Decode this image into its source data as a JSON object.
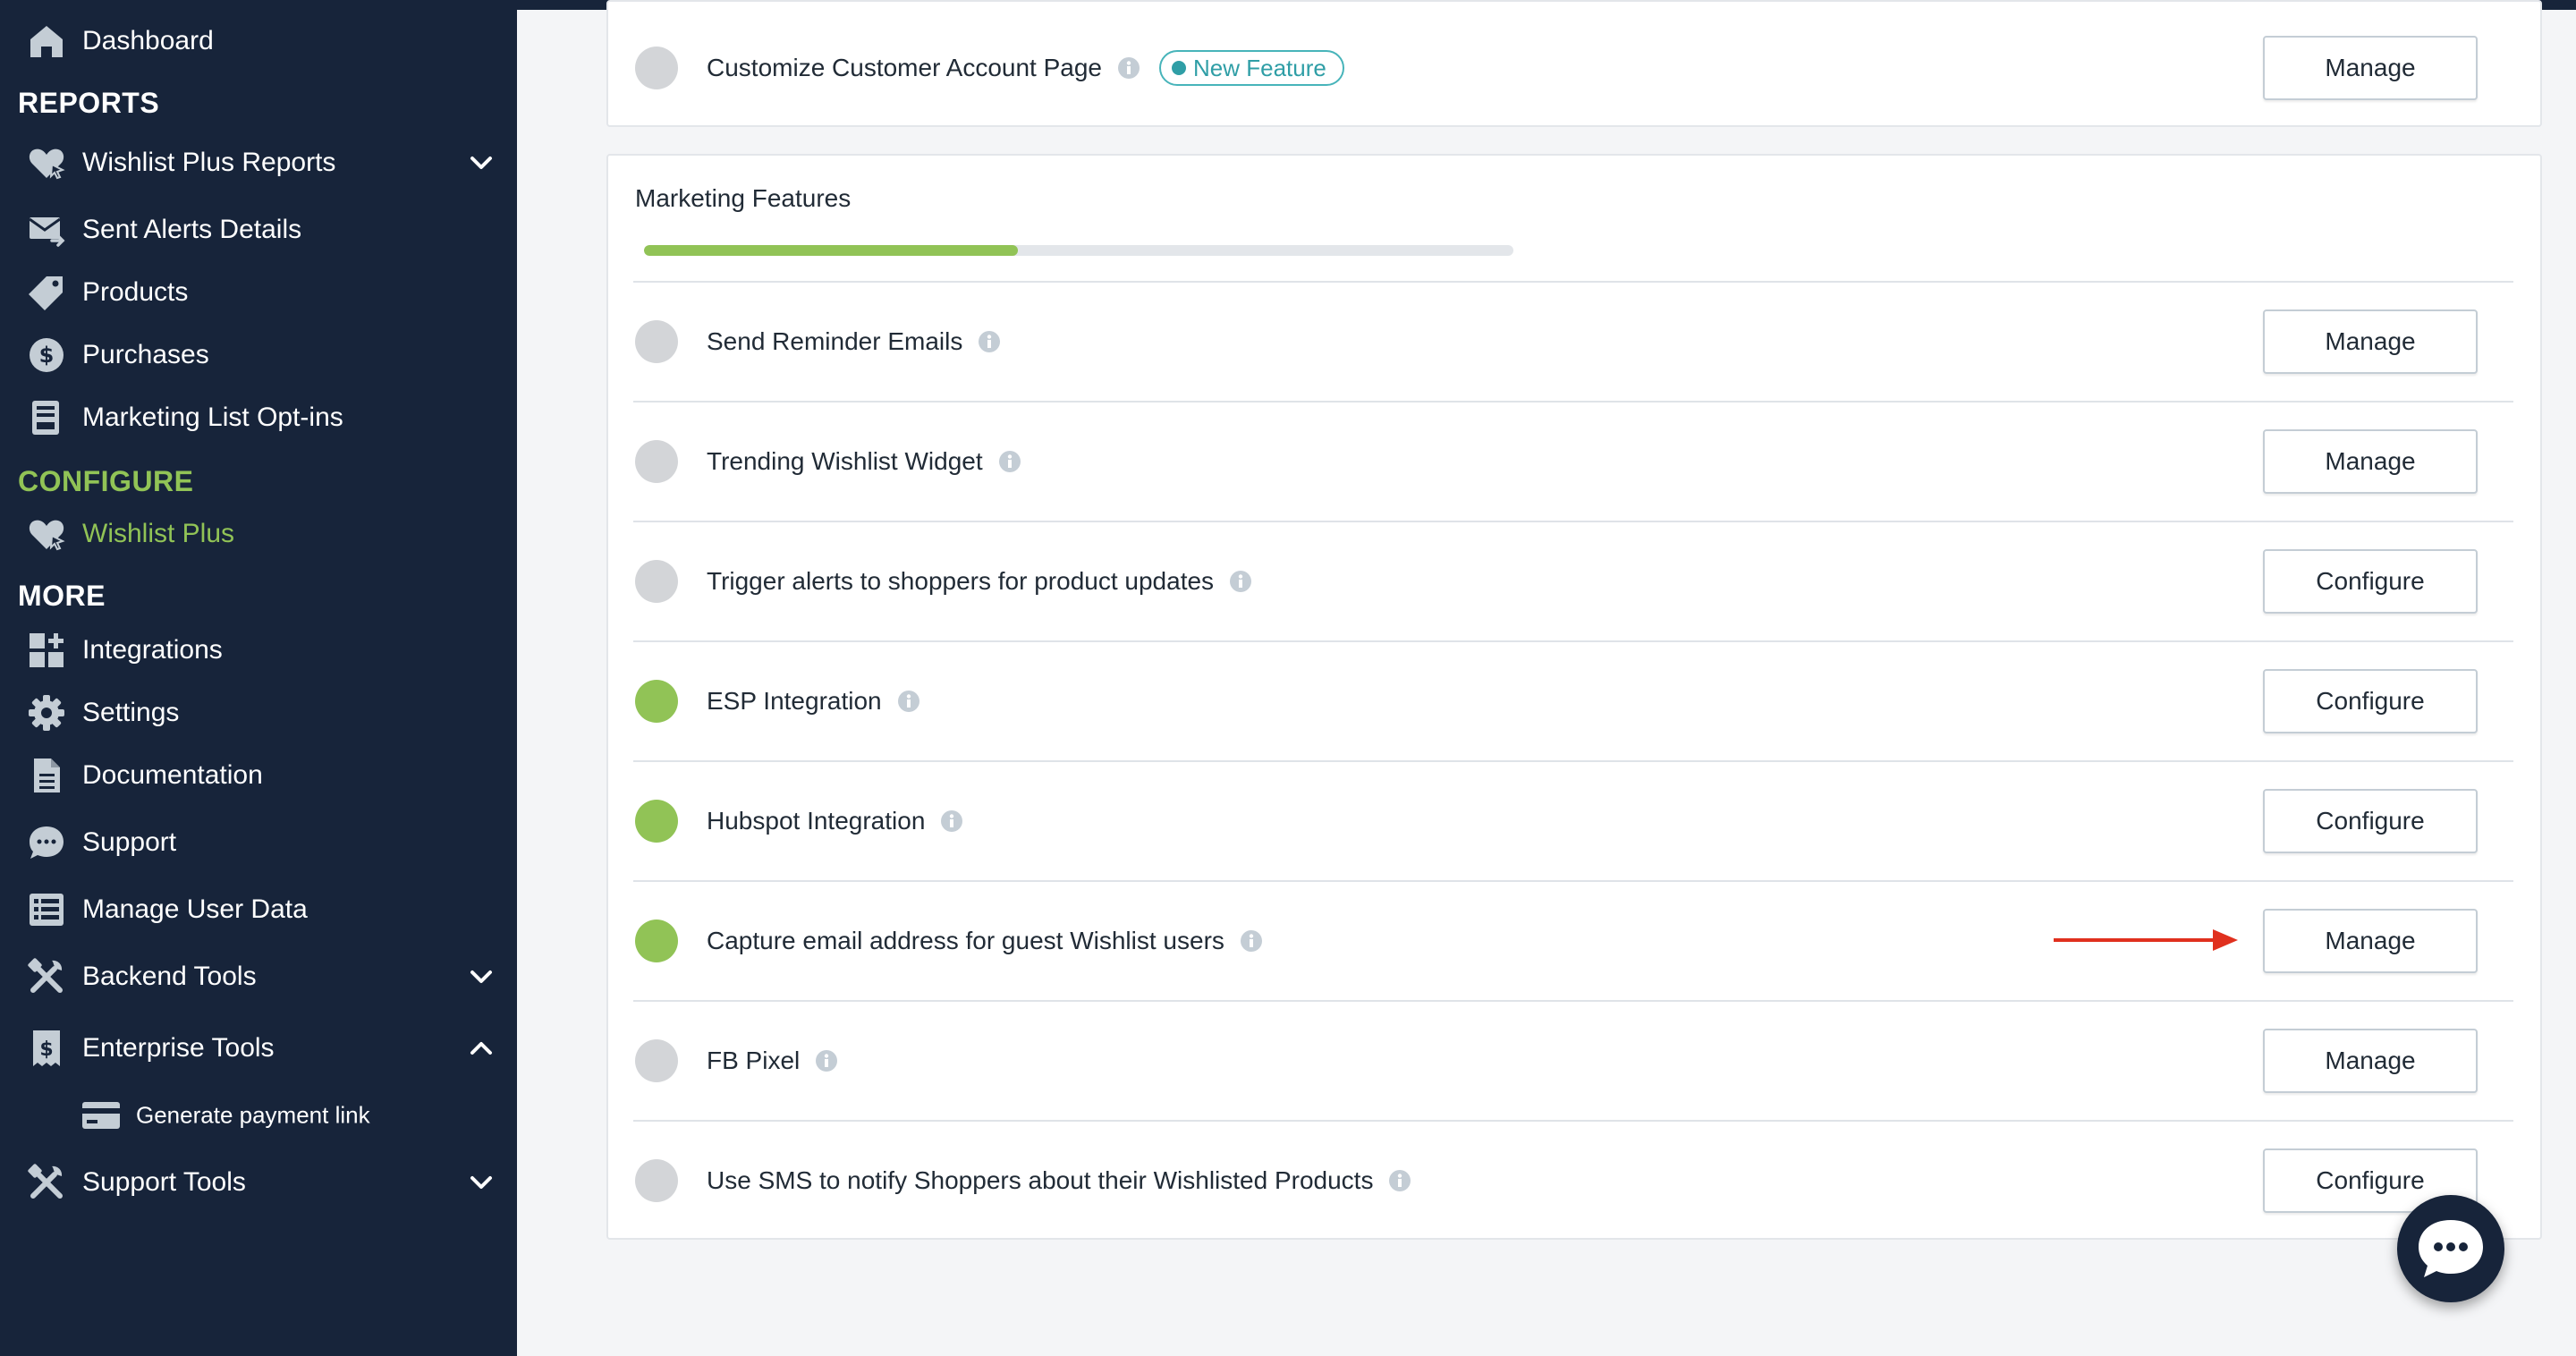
{
  "sidebar": {
    "dashboard": "Dashboard",
    "reports_header": "REPORTS",
    "reports": [
      "Wishlist Plus Reports",
      "Sent Alerts Details",
      "Products",
      "Purchases",
      "Marketing List Opt-ins"
    ],
    "configure_header": "CONFIGURE",
    "configure_item": "Wishlist Plus",
    "more_header": "MORE",
    "more": [
      "Integrations",
      "Settings",
      "Documentation",
      "Support",
      "Manage User Data",
      "Backend Tools",
      "Enterprise Tools"
    ],
    "enterprise_sub": "Generate payment link",
    "support_tools": "Support Tools"
  },
  "top_row": {
    "label": "Customize Customer Account Page",
    "badge": "New Feature",
    "button": "Manage",
    "enabled": false
  },
  "marketing": {
    "title": "Marketing Features",
    "progress": 0.43,
    "rows": [
      {
        "label": "Send Reminder Emails",
        "button": "Manage",
        "enabled": false
      },
      {
        "label": "Trending Wishlist Widget",
        "button": "Manage",
        "enabled": false
      },
      {
        "label": "Trigger alerts to shoppers for product updates",
        "button": "Configure",
        "enabled": false
      },
      {
        "label": "ESP Integration",
        "button": "Configure",
        "enabled": true
      },
      {
        "label": "Hubspot Integration",
        "button": "Configure",
        "enabled": true
      },
      {
        "label": "Capture email address for guest Wishlist users",
        "button": "Manage",
        "enabled": true
      },
      {
        "label": "FB Pixel",
        "button": "Manage",
        "enabled": false
      },
      {
        "label": "Use SMS to notify Shoppers about their Wishlisted Products",
        "button": "Configure",
        "enabled": false
      }
    ]
  },
  "colors": {
    "sidebar_bg": "#17243a",
    "accent_green": "#91c356",
    "inactive_dot": "#d3d5d8",
    "badge_teal": "#2f9ea6",
    "arrow_red": "#e0301e"
  },
  "icons": {
    "dashboard": "home-icon",
    "reports": "heart-icon",
    "sent_alerts": "mail-icon",
    "products": "tag-icon",
    "purchases": "dollar-icon",
    "optins": "inbox-icon",
    "integrations": "grid-plus-icon",
    "settings": "gear-icon",
    "documentation": "document-icon",
    "support": "chat-icon",
    "manage_user_data": "list-icon",
    "backend_tools": "tools-icon",
    "enterprise_tools": "receipt-dollar-icon",
    "payment_link": "credit-card-icon",
    "support_tools": "tools-icon",
    "chat_fab": "chat-bubble-icon",
    "info": "info-icon",
    "arrow": "arrow-right-icon"
  }
}
